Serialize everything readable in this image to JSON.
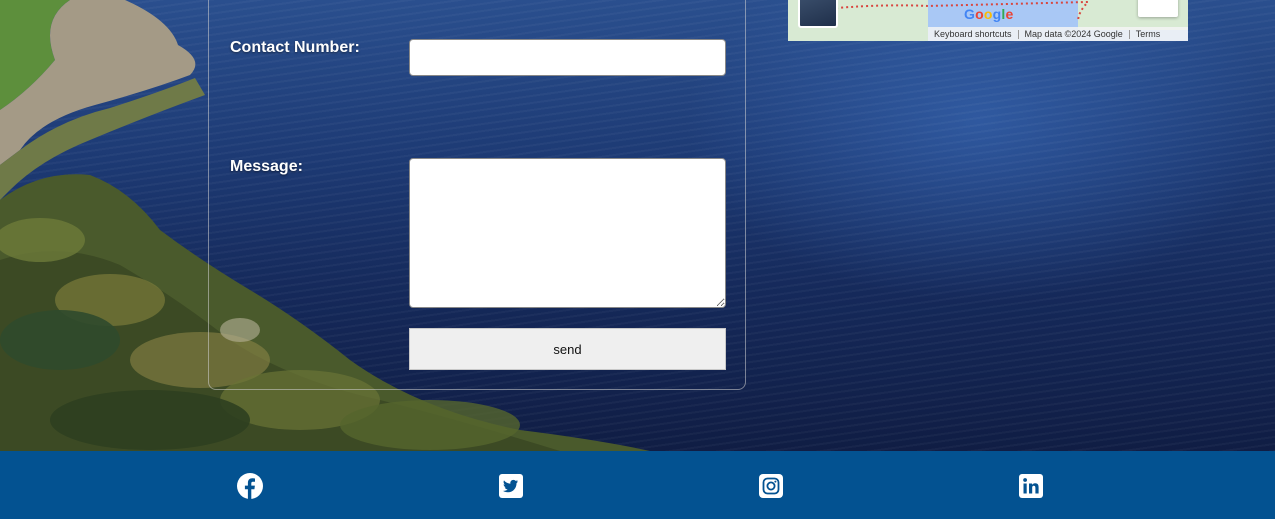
{
  "form": {
    "contact_label": "Contact Number:",
    "contact_value": "",
    "message_label": "Message:",
    "message_value": "",
    "send_label": "send"
  },
  "map": {
    "logo": "Google",
    "keyboard_shortcuts": "Keyboard shortcuts",
    "map_data": "Map data ©2024 Google",
    "terms": "Terms"
  },
  "footer": {
    "social": [
      {
        "name": "facebook-icon"
      },
      {
        "name": "twitter-icon"
      },
      {
        "name": "instagram-icon"
      },
      {
        "name": "linkedin-icon"
      }
    ]
  },
  "colors": {
    "footer_bg": "#035291",
    "icon": "#ffffff",
    "label": "#ffffff"
  }
}
